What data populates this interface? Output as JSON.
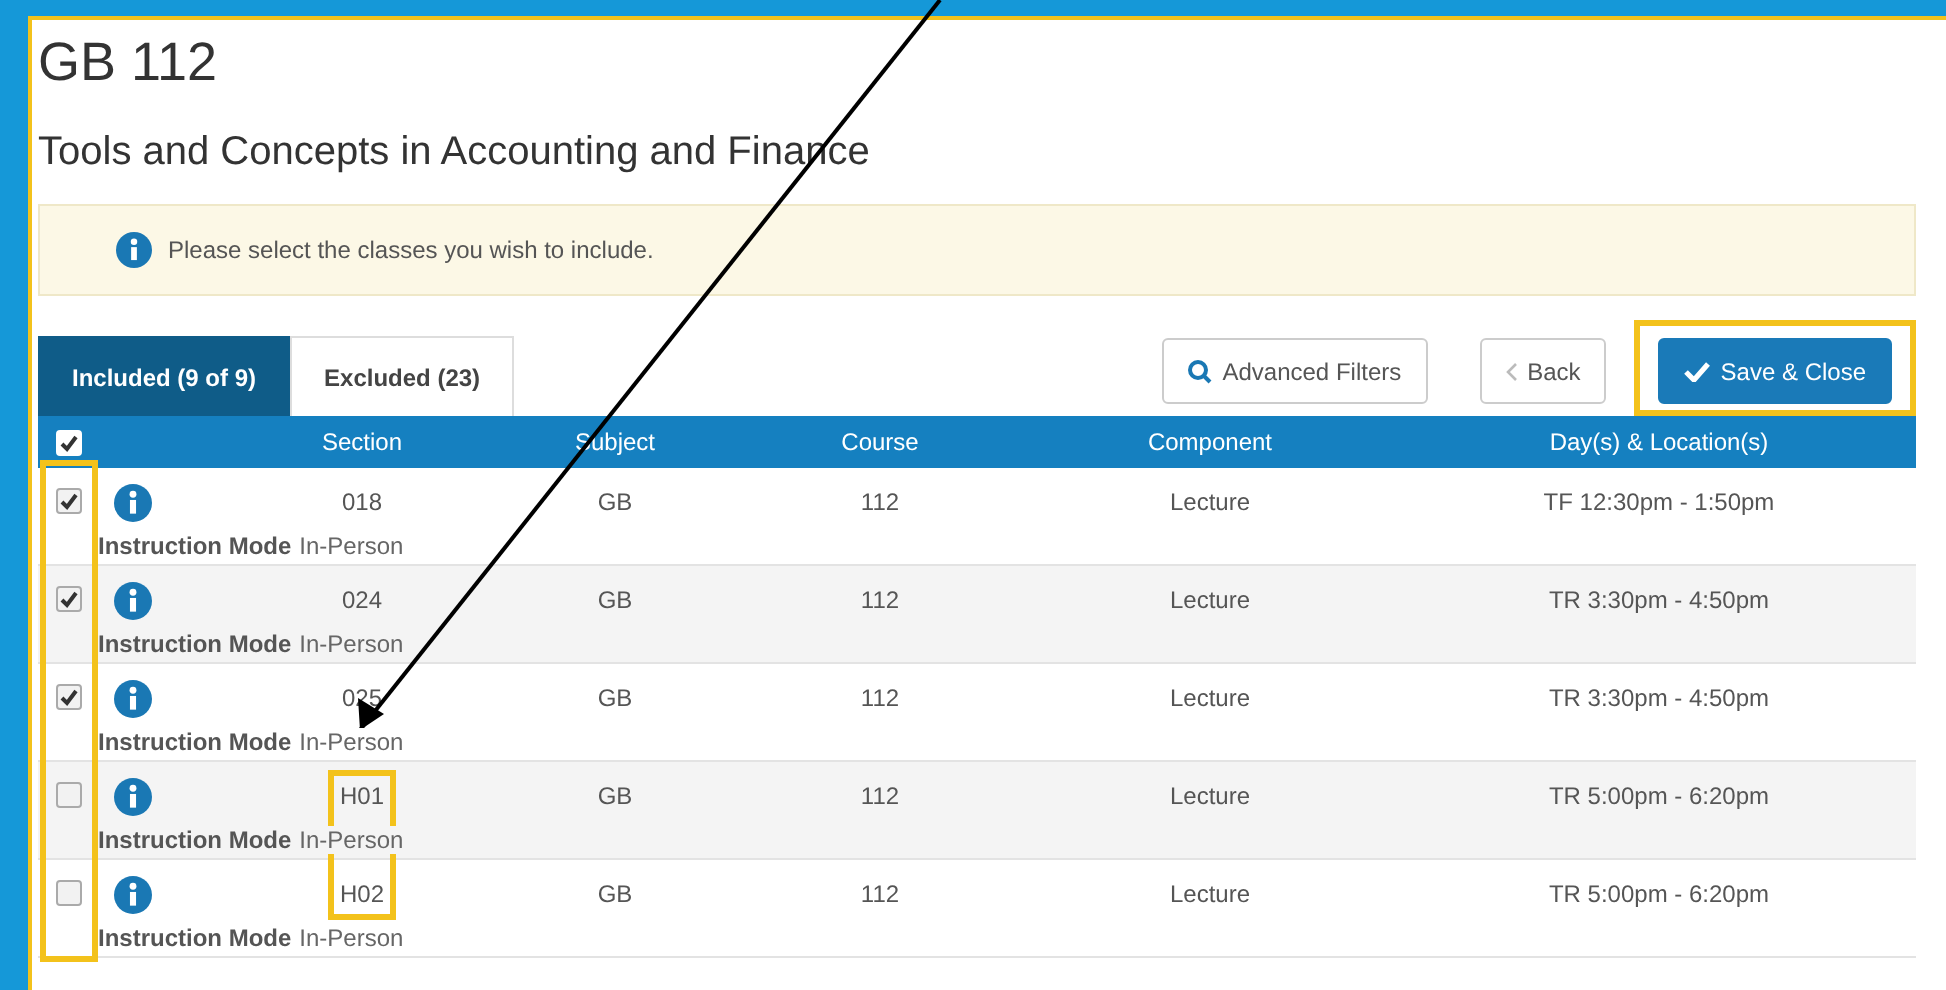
{
  "page": {
    "title": "GB 112",
    "subtitle": "Tools and Concepts in Accounting and Finance"
  },
  "alert": {
    "text": "Please select the classes you wish to include."
  },
  "tabs": [
    {
      "label": "Included (9 of 9)",
      "selected": true
    },
    {
      "label": "Excluded (23)",
      "selected": false
    }
  ],
  "buttons": [
    {
      "kind": "filter",
      "label": "Advanced Filters",
      "highlighted": false
    },
    {
      "kind": "back",
      "label": "Back",
      "highlighted": false
    },
    {
      "kind": "save",
      "label": "Save & Close",
      "highlighted": true
    }
  ],
  "table": {
    "all_checked": true,
    "checkbox_column_highlighted": true,
    "columns": [
      "Section",
      "Subject",
      "Course",
      "Component",
      "Day(s) & Location(s)"
    ],
    "rows": [
      {
        "checked": true,
        "section": "018",
        "subject": "GB",
        "course": "112",
        "component": "Lecture",
        "days": "TF 12:30pm - 1:50pm",
        "mode_label": "Instruction Mode",
        "mode": "In-Person",
        "section_highlighted": false
      },
      {
        "checked": true,
        "section": "024",
        "subject": "GB",
        "course": "112",
        "component": "Lecture",
        "days": "TR 3:30pm - 4:50pm",
        "mode_label": "Instruction Mode",
        "mode": "In-Person",
        "section_highlighted": false
      },
      {
        "checked": true,
        "section": "025",
        "subject": "GB",
        "course": "112",
        "component": "Lecture",
        "days": "TR 3:30pm - 4:50pm",
        "mode_label": "Instruction Mode",
        "mode": "In-Person",
        "section_highlighted": false
      },
      {
        "checked": false,
        "section": "H01",
        "subject": "GB",
        "course": "112",
        "component": "Lecture",
        "days": "TR 5:00pm - 6:20pm",
        "mode_label": "Instruction Mode",
        "mode": "In-Person",
        "section_highlighted": true
      },
      {
        "checked": false,
        "section": "H02",
        "subject": "GB",
        "course": "112",
        "component": "Lecture",
        "days": "TR 5:00pm - 6:20pm",
        "mode_label": "Instruction Mode",
        "mode": "In-Person",
        "section_highlighted": true
      }
    ]
  },
  "annotation_arrow": true
}
